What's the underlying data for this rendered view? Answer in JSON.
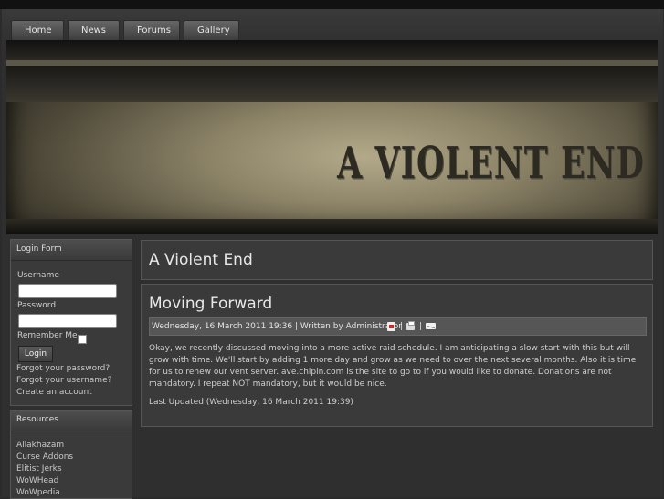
{
  "nav": {
    "items": [
      {
        "label": "Home"
      },
      {
        "label": "News"
      },
      {
        "label": "Forums"
      },
      {
        "label": "Gallery"
      }
    ]
  },
  "header": {
    "banner_title": "A VIOLENT END"
  },
  "login_module": {
    "title": "Login Form",
    "username_label": "Username",
    "username_value": "",
    "password_label": "Password",
    "password_value": "",
    "remember_label": "Remember Me",
    "remember_checked": false,
    "login_button": "Login",
    "links": [
      "Forgot your password?",
      "Forgot your username?",
      "Create an account"
    ]
  },
  "resources_module": {
    "title": "Resources",
    "links": [
      "Allakhazam",
      "Curse Addons",
      "Elitist Jerks",
      "WoWHead",
      "WoWpedia"
    ]
  },
  "main": {
    "site_title": "A Violent End",
    "article": {
      "title": "Moving Forward",
      "meta": "Wednesday, 16 March 2011 19:36 | Written by Administrator |",
      "icons": [
        "pdf-icon",
        "print-icon",
        "email-icon"
      ],
      "separator": "|",
      "body": "Okay, we recently discussed moving into a more active raid schedule. I am anticipating a slow start with this but will grow with time. We'll start by adding 1 more day and grow as we need to over the next several months. Also it is time for us to renew our vent server. ave.chipin.com is the site to go to if you would like to donate. Donations are not mandatory. I repeat NOT mandatory, but it would be nice.",
      "last_updated": "Last Updated (Wednesday, 16 March 2011 19:39)"
    }
  }
}
